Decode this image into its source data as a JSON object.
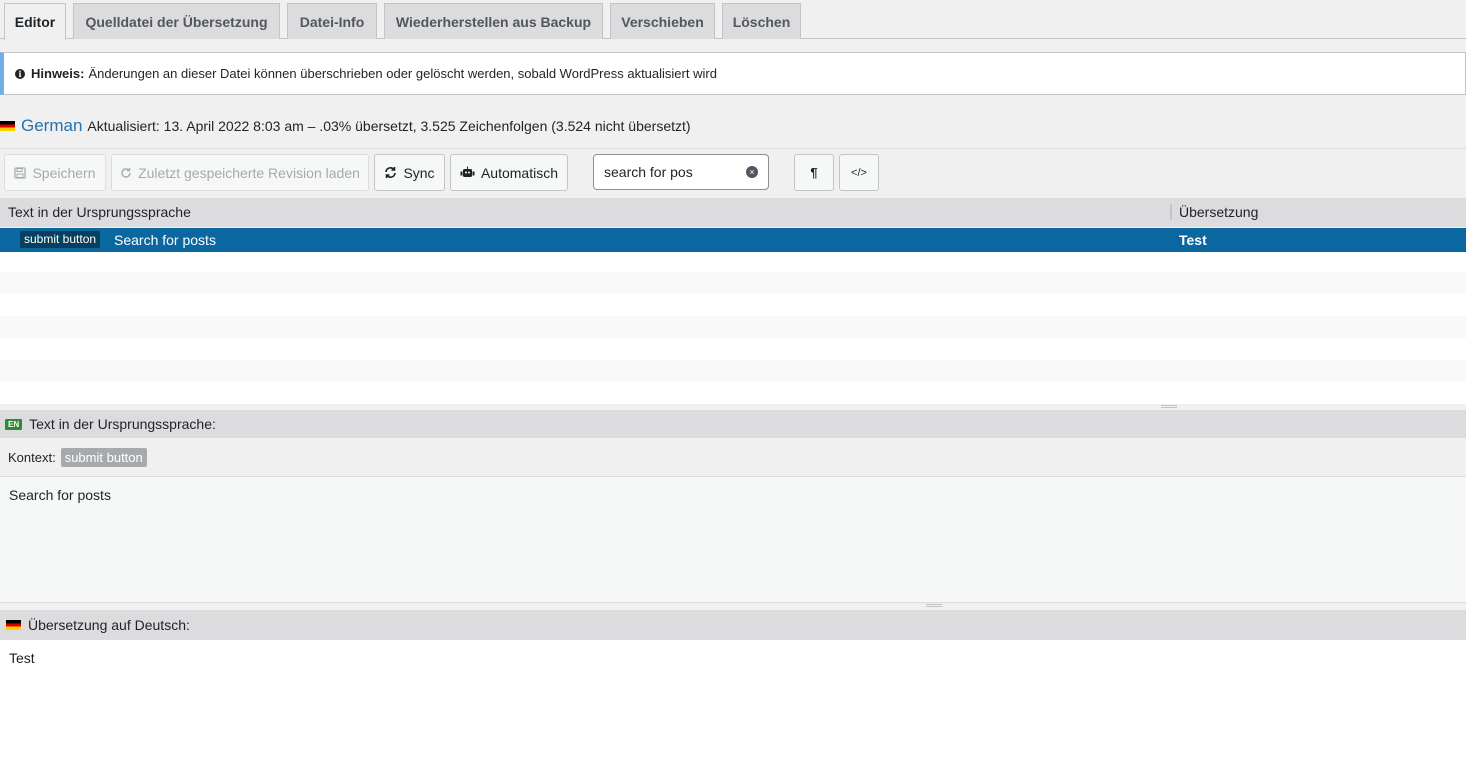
{
  "tabs": [
    {
      "label": "Editor",
      "active": true
    },
    {
      "label": "Quelldatei der Übersetzung"
    },
    {
      "label": "Datei-Info"
    },
    {
      "label": "Wiederherstellen aus Backup"
    },
    {
      "label": "Verschieben"
    },
    {
      "label": "Löschen"
    }
  ],
  "notice": {
    "icon": "info-icon",
    "bold": "Hinweis:",
    "text": "Änderungen an dieser Datei können überschrieben oder gelöscht werden, sobald WordPress aktualisiert wird"
  },
  "locale": {
    "name": "German",
    "meta": "Aktualisiert: 13. April 2022 8:03 am – .03% übersetzt, 3.525 Zeichenfolgen (3.524 nicht übersetzt)"
  },
  "toolbar": {
    "save_label": "Speichern",
    "revision_label": "Zuletzt gespeicherte Revision laden",
    "sync_label": "Sync",
    "auto_label": "Automatisch",
    "search_value": "search for pos",
    "pilcrow_label": "¶",
    "code_label": "</>"
  },
  "table": {
    "col_source": "Text in der Ursprungssprache",
    "col_target": "Übersetzung",
    "rows": [
      {
        "context": "submit button",
        "source": "Search for posts",
        "target": "Test"
      }
    ]
  },
  "source_pane": {
    "lang_badge": "EN",
    "heading": "Text in der Ursprungssprache:",
    "context_label": "Kontext:",
    "context_value": "submit button",
    "text": "Search for posts"
  },
  "target_pane": {
    "heading": "Übersetzung auf Deutsch:",
    "text": "Test"
  },
  "colors": {
    "selected_row": "#0a67a0",
    "locale_link": "#2271b1",
    "notice_accent": "#72aee6"
  }
}
